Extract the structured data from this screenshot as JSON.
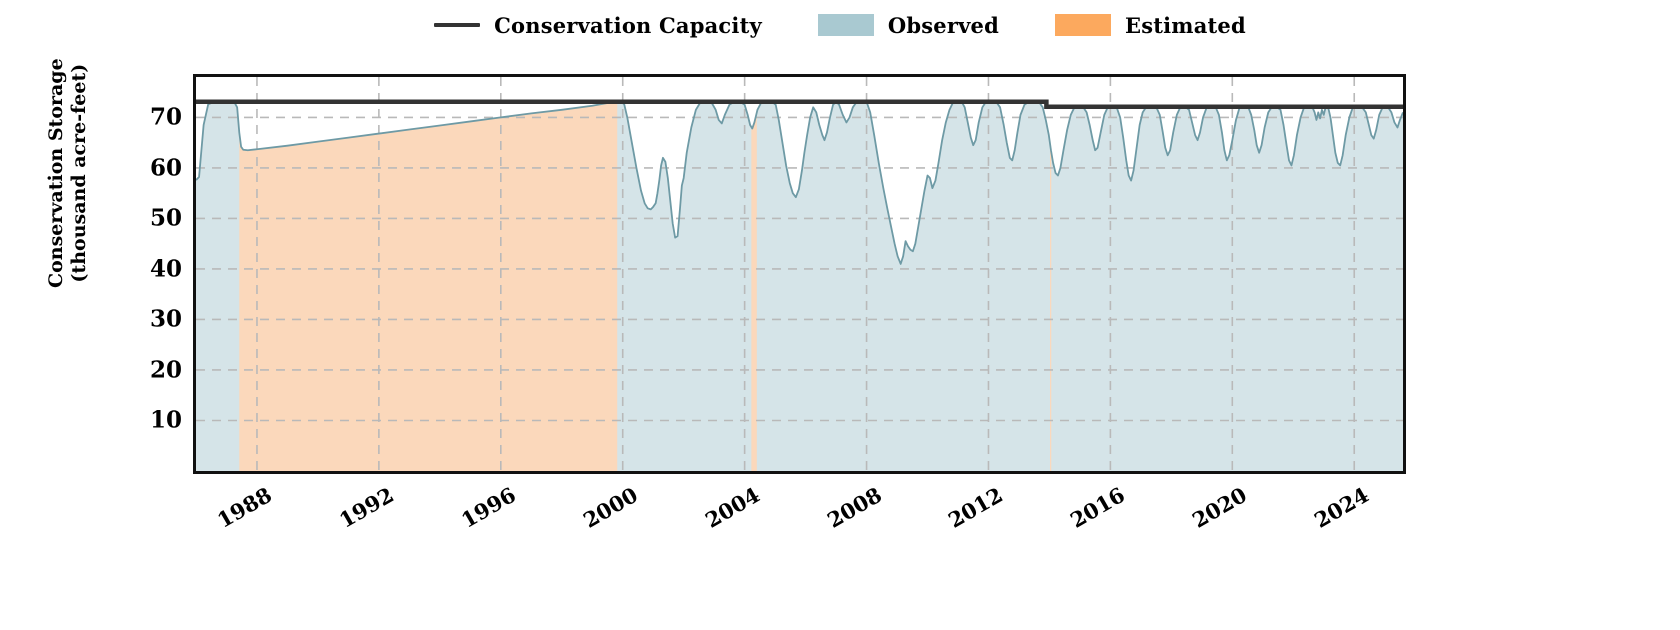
{
  "legend": {
    "items": [
      {
        "label": "Conservation Capacity",
        "kind": "line",
        "color": "#333333"
      },
      {
        "label": "Observed",
        "kind": "swatch",
        "color": "#a9c9d1"
      },
      {
        "label": "Estimated",
        "kind": "swatch",
        "color": "#fca95e"
      }
    ]
  },
  "axes": {
    "ylabel_line1": "Conservation Storage",
    "ylabel_line2": "(thousand acre-feet)"
  },
  "chart_data": {
    "type": "area",
    "title": "",
    "xlabel": "",
    "ylabel": "Conservation Storage (thousand acre-feet)",
    "xlim": [
      1986.0,
      2025.6
    ],
    "ylim": [
      0,
      78
    ],
    "grid": true,
    "legend_position": "top-center",
    "yticks": [
      10,
      20,
      30,
      40,
      50,
      60,
      70
    ],
    "xticks": [
      1988,
      1992,
      1996,
      2000,
      2004,
      2008,
      2012,
      2016,
      2020,
      2024
    ],
    "series": [
      {
        "name": "Conservation Capacity",
        "type": "step-line",
        "color": "#333333",
        "points": [
          [
            1986.0,
            73.1
          ],
          [
            2013.9,
            73.1
          ],
          [
            2013.9,
            72.1
          ],
          [
            2025.6,
            72.1
          ]
        ]
      },
      {
        "name": "Conservation Storage",
        "type": "area",
        "fill_observed": "#d5e4e8",
        "fill_estimated": "#fbd8bb",
        "line_color": "#6e9aa5",
        "values": [
          [
            1986.0,
            57.6
          ],
          [
            1986.1,
            58.2
          ],
          [
            1986.25,
            68.5
          ],
          [
            1986.4,
            72.6
          ],
          [
            1986.6,
            73.1
          ],
          [
            1986.9,
            73.1
          ],
          [
            1987.1,
            73.1
          ],
          [
            1987.25,
            73.1
          ],
          [
            1987.35,
            72.0
          ],
          [
            1987.42,
            67.0
          ],
          [
            1987.48,
            64.2
          ],
          [
            1987.55,
            63.6
          ],
          [
            1987.7,
            63.5
          ],
          [
            1988.0,
            63.7
          ],
          [
            1989.0,
            64.4
          ],
          [
            1990.0,
            65.2
          ],
          [
            1991.0,
            66.0
          ],
          [
            1992.0,
            66.8
          ],
          [
            1993.0,
            67.6
          ],
          [
            1994.0,
            68.4
          ],
          [
            1995.0,
            69.2
          ],
          [
            1996.0,
            70.0
          ],
          [
            1997.0,
            70.8
          ],
          [
            1998.0,
            71.5
          ],
          [
            1999.0,
            72.3
          ],
          [
            1999.55,
            72.9
          ],
          [
            1999.8,
            73.1
          ],
          [
            1999.95,
            73.1
          ],
          [
            2000.05,
            72.6
          ],
          [
            2000.15,
            70.0
          ],
          [
            2000.3,
            65.0
          ],
          [
            2000.45,
            60.0
          ],
          [
            2000.6,
            55.5
          ],
          [
            2000.72,
            53.0
          ],
          [
            2000.82,
            52.0
          ],
          [
            2000.92,
            51.8
          ],
          [
            2001.0,
            52.3
          ],
          [
            2001.08,
            53.0
          ],
          [
            2001.14,
            55.0
          ],
          [
            2001.2,
            57.5
          ],
          [
            2001.26,
            60.5
          ],
          [
            2001.32,
            62.0
          ],
          [
            2001.4,
            61.2
          ],
          [
            2001.48,
            58.0
          ],
          [
            2001.56,
            53.5
          ],
          [
            2001.64,
            49.0
          ],
          [
            2001.72,
            46.2
          ],
          [
            2001.8,
            46.5
          ],
          [
            2001.88,
            52.0
          ],
          [
            2001.94,
            56.5
          ],
          [
            2002.0,
            58.0
          ],
          [
            2002.1,
            63.0
          ],
          [
            2002.25,
            68.0
          ],
          [
            2002.4,
            71.5
          ],
          [
            2002.55,
            73.0
          ],
          [
            2002.75,
            73.1
          ],
          [
            2002.9,
            73.1
          ],
          [
            2003.05,
            71.5
          ],
          [
            2003.15,
            69.5
          ],
          [
            2003.25,
            68.8
          ],
          [
            2003.35,
            70.5
          ],
          [
            2003.5,
            72.5
          ],
          [
            2003.65,
            73.1
          ],
          [
            2003.85,
            73.1
          ],
          [
            2004.0,
            72.5
          ],
          [
            2004.1,
            70.5
          ],
          [
            2004.18,
            68.5
          ],
          [
            2004.25,
            67.8
          ],
          [
            2004.32,
            69.0
          ],
          [
            2004.42,
            71.5
          ],
          [
            2004.55,
            73.0
          ],
          [
            2004.75,
            73.1
          ],
          [
            2004.9,
            73.1
          ],
          [
            2005.02,
            72.5
          ],
          [
            2005.12,
            69.5
          ],
          [
            2005.24,
            65.0
          ],
          [
            2005.36,
            60.5
          ],
          [
            2005.48,
            57.0
          ],
          [
            2005.58,
            55.0
          ],
          [
            2005.68,
            54.2
          ],
          [
            2005.78,
            55.8
          ],
          [
            2005.88,
            59.5
          ],
          [
            2005.96,
            63.0
          ],
          [
            2006.05,
            66.5
          ],
          [
            2006.15,
            70.0
          ],
          [
            2006.25,
            72.0
          ],
          [
            2006.35,
            71.0
          ],
          [
            2006.45,
            68.5
          ],
          [
            2006.55,
            66.5
          ],
          [
            2006.62,
            65.5
          ],
          [
            2006.7,
            67.0
          ],
          [
            2006.8,
            70.0
          ],
          [
            2006.9,
            72.5
          ],
          [
            2007.0,
            73.1
          ],
          [
            2007.1,
            72.5
          ],
          [
            2007.22,
            70.5
          ],
          [
            2007.34,
            69.0
          ],
          [
            2007.44,
            70.0
          ],
          [
            2007.55,
            72.0
          ],
          [
            2007.68,
            73.1
          ],
          [
            2007.85,
            73.1
          ],
          [
            2008.0,
            73.1
          ],
          [
            2008.12,
            71.0
          ],
          [
            2008.25,
            66.5
          ],
          [
            2008.4,
            61.0
          ],
          [
            2008.55,
            56.0
          ],
          [
            2008.68,
            52.0
          ],
          [
            2008.8,
            48.5
          ],
          [
            2008.92,
            45.0
          ],
          [
            2009.02,
            42.5
          ],
          [
            2009.12,
            41.0
          ],
          [
            2009.2,
            42.5
          ],
          [
            2009.28,
            45.5
          ],
          [
            2009.36,
            44.5
          ],
          [
            2009.44,
            43.8
          ],
          [
            2009.52,
            43.5
          ],
          [
            2009.6,
            45.0
          ],
          [
            2009.7,
            48.5
          ],
          [
            2009.8,
            52.0
          ],
          [
            2009.9,
            55.5
          ],
          [
            2010.0,
            58.5
          ],
          [
            2010.08,
            58.0
          ],
          [
            2010.16,
            56.0
          ],
          [
            2010.26,
            57.5
          ],
          [
            2010.36,
            61.0
          ],
          [
            2010.48,
            65.5
          ],
          [
            2010.6,
            69.0
          ],
          [
            2010.72,
            71.5
          ],
          [
            2010.84,
            73.0
          ],
          [
            2011.0,
            73.1
          ],
          [
            2011.12,
            73.1
          ],
          [
            2011.22,
            72.0
          ],
          [
            2011.32,
            69.0
          ],
          [
            2011.42,
            66.0
          ],
          [
            2011.5,
            64.5
          ],
          [
            2011.58,
            65.5
          ],
          [
            2011.68,
            69.0
          ],
          [
            2011.8,
            72.0
          ],
          [
            2011.92,
            73.1
          ],
          [
            2012.1,
            73.1
          ],
          [
            2012.25,
            73.1
          ],
          [
            2012.38,
            72.0
          ],
          [
            2012.5,
            68.5
          ],
          [
            2012.6,
            65.0
          ],
          [
            2012.7,
            62.0
          ],
          [
            2012.78,
            61.5
          ],
          [
            2012.86,
            63.5
          ],
          [
            2012.95,
            67.0
          ],
          [
            2013.05,
            70.5
          ],
          [
            2013.18,
            72.5
          ],
          [
            2013.32,
            73.1
          ],
          [
            2013.5,
            73.1
          ],
          [
            2013.65,
            73.1
          ],
          [
            2013.78,
            72.0
          ],
          [
            2013.88,
            69.5
          ],
          [
            2013.98,
            66.5
          ],
          [
            2014.05,
            63.5
          ],
          [
            2014.12,
            61.0
          ],
          [
            2014.2,
            59.0
          ],
          [
            2014.28,
            58.5
          ],
          [
            2014.36,
            60.0
          ],
          [
            2014.46,
            63.5
          ],
          [
            2014.58,
            67.5
          ],
          [
            2014.7,
            70.5
          ],
          [
            2014.82,
            72.0
          ],
          [
            2014.95,
            72.1
          ],
          [
            2015.1,
            72.1
          ],
          [
            2015.22,
            71.0
          ],
          [
            2015.32,
            68.5
          ],
          [
            2015.42,
            65.5
          ],
          [
            2015.5,
            63.5
          ],
          [
            2015.58,
            64.0
          ],
          [
            2015.68,
            67.0
          ],
          [
            2015.8,
            70.5
          ],
          [
            2015.92,
            72.1
          ],
          [
            2016.08,
            72.1
          ],
          [
            2016.2,
            72.1
          ],
          [
            2016.32,
            70.0
          ],
          [
            2016.42,
            66.0
          ],
          [
            2016.52,
            61.5
          ],
          [
            2016.6,
            58.5
          ],
          [
            2016.68,
            57.5
          ],
          [
            2016.76,
            59.5
          ],
          [
            2016.86,
            64.0
          ],
          [
            2016.96,
            68.5
          ],
          [
            2017.06,
            71.0
          ],
          [
            2017.18,
            72.1
          ],
          [
            2017.35,
            72.1
          ],
          [
            2017.5,
            72.1
          ],
          [
            2017.62,
            70.5
          ],
          [
            2017.72,
            67.0
          ],
          [
            2017.8,
            64.0
          ],
          [
            2017.88,
            62.5
          ],
          [
            2017.96,
            63.5
          ],
          [
            2018.06,
            67.0
          ],
          [
            2018.18,
            70.5
          ],
          [
            2018.3,
            72.1
          ],
          [
            2018.45,
            72.1
          ],
          [
            2018.58,
            71.5
          ],
          [
            2018.68,
            69.0
          ],
          [
            2018.78,
            66.5
          ],
          [
            2018.86,
            65.5
          ],
          [
            2018.94,
            67.0
          ],
          [
            2019.04,
            70.0
          ],
          [
            2019.16,
            72.0
          ],
          [
            2019.3,
            72.1
          ],
          [
            2019.45,
            72.1
          ],
          [
            2019.56,
            70.5
          ],
          [
            2019.66,
            67.0
          ],
          [
            2019.74,
            63.5
          ],
          [
            2019.82,
            61.5
          ],
          [
            2019.9,
            62.5
          ],
          [
            2020.0,
            65.5
          ],
          [
            2020.12,
            69.5
          ],
          [
            2020.24,
            72.0
          ],
          [
            2020.38,
            72.1
          ],
          [
            2020.52,
            72.1
          ],
          [
            2020.62,
            70.5
          ],
          [
            2020.72,
            67.5
          ],
          [
            2020.8,
            64.5
          ],
          [
            2020.88,
            63.0
          ],
          [
            2020.96,
            64.5
          ],
          [
            2021.06,
            68.0
          ],
          [
            2021.18,
            71.0
          ],
          [
            2021.3,
            72.1
          ],
          [
            2021.45,
            72.1
          ],
          [
            2021.58,
            71.5
          ],
          [
            2021.68,
            68.5
          ],
          [
            2021.78,
            64.5
          ],
          [
            2021.86,
            61.5
          ],
          [
            2021.94,
            60.5
          ],
          [
            2022.02,
            62.5
          ],
          [
            2022.12,
            66.5
          ],
          [
            2022.24,
            70.0
          ],
          [
            2022.36,
            72.1
          ],
          [
            2022.5,
            72.1
          ],
          [
            2022.62,
            72.1
          ],
          [
            2022.7,
            71.0
          ],
          [
            2022.76,
            69.5
          ],
          [
            2022.82,
            71.0
          ],
          [
            2022.88,
            69.8
          ],
          [
            2022.94,
            71.5
          ],
          [
            2023.0,
            70.5
          ],
          [
            2023.06,
            72.0
          ],
          [
            2023.14,
            72.1
          ],
          [
            2023.22,
            70.0
          ],
          [
            2023.3,
            66.5
          ],
          [
            2023.38,
            63.0
          ],
          [
            2023.46,
            61.0
          ],
          [
            2023.54,
            60.5
          ],
          [
            2023.62,
            62.5
          ],
          [
            2023.72,
            66.5
          ],
          [
            2023.84,
            70.0
          ],
          [
            2023.96,
            72.1
          ],
          [
            2024.1,
            72.1
          ],
          [
            2024.25,
            72.1
          ],
          [
            2024.38,
            71.0
          ],
          [
            2024.48,
            68.5
          ],
          [
            2024.56,
            66.5
          ],
          [
            2024.64,
            65.8
          ],
          [
            2024.72,
            67.5
          ],
          [
            2024.82,
            70.5
          ],
          [
            2024.94,
            72.1
          ],
          [
            2025.1,
            72.1
          ],
          [
            2025.22,
            71.0
          ],
          [
            2025.32,
            69.0
          ],
          [
            2025.42,
            68.0
          ],
          [
            2025.5,
            69.5
          ],
          [
            2025.6,
            71.0
          ]
        ],
        "estimated_spans": [
          [
            1987.42,
            1999.82
          ],
          [
            2004.22,
            2004.4
          ],
          [
            2014.02,
            2014.06
          ]
        ]
      }
    ]
  }
}
